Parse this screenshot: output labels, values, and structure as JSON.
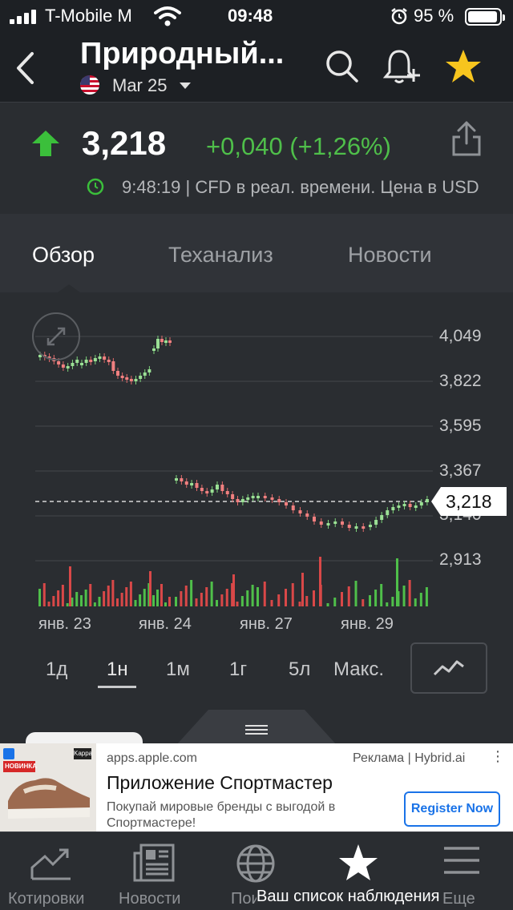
{
  "status_bar": {
    "carrier": "T-Mobile M",
    "time": "09:48",
    "battery": "95 %"
  },
  "header": {
    "title": "Природный...",
    "contract": "Mar 25"
  },
  "quote": {
    "price": "3,218",
    "change": "+0,040 (+1,26%)",
    "timestamp": "9:48:19 | CFD в реал. времени. Цена в USD",
    "up_color": "#3bbf3b"
  },
  "tabs": [
    {
      "label": "Обзор"
    },
    {
      "label": "Теханализ"
    },
    {
      "label": "Новости"
    }
  ],
  "chart": {
    "y_labels": [
      "4,049",
      "3,822",
      "3,595",
      "3,367",
      "3,140",
      "2,913"
    ],
    "x_labels": [
      "янв. 23",
      "янв. 24",
      "янв. 27",
      "янв. 29"
    ],
    "last_price": "3,218"
  },
  "periods": [
    {
      "label": "1д"
    },
    {
      "label": "1н"
    },
    {
      "label": "1м"
    },
    {
      "label": "1г"
    },
    {
      "label": "5л"
    },
    {
      "label": "Макс."
    }
  ],
  "ad": {
    "source": "apps.apple.com",
    "label": "Реклама | Hybrid.ai",
    "title": "Приложение Спортмастер",
    "description": "Покупай мировые бренды с выгодой в Спортмастере!",
    "cta": "Register Now",
    "badge": "НОВИНКА",
    "brand": "Kappa"
  },
  "nav": [
    {
      "label": "Котировки"
    },
    {
      "label": "Новости"
    },
    {
      "label": "Поиск"
    },
    {
      "label": "Ваш список наблюдения"
    },
    {
      "label": "Еще"
    }
  ]
}
